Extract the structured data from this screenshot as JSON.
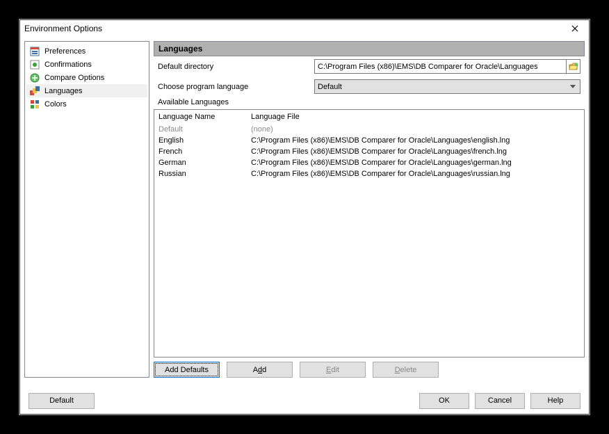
{
  "window": {
    "title": "Environment Options"
  },
  "sidebar": {
    "items": [
      {
        "label": "Preferences"
      },
      {
        "label": "Confirmations"
      },
      {
        "label": "Compare Options"
      },
      {
        "label": "Languages"
      },
      {
        "label": "Colors"
      }
    ]
  },
  "main": {
    "section_title": "Languages",
    "dir_label": "Default directory",
    "dir_value": "C:\\Program Files (x86)\\EMS\\DB Comparer for Oracle\\Languages",
    "lang_label": "Choose program language",
    "lang_value": "Default",
    "avail_label": "Available Languages",
    "columns": {
      "name": "Language Name",
      "file": "Language File"
    },
    "rows": [
      {
        "name": "Default",
        "file": "(none)",
        "grayed": true
      },
      {
        "name": "English",
        "file": "C:\\Program Files (x86)\\EMS\\DB Comparer for Oracle\\Languages\\english.lng"
      },
      {
        "name": "French",
        "file": "C:\\Program Files (x86)\\EMS\\DB Comparer for Oracle\\Languages\\french.lng"
      },
      {
        "name": "German",
        "file": "C:\\Program Files (x86)\\EMS\\DB Comparer for Oracle\\Languages\\german.lng"
      },
      {
        "name": "Russian",
        "file": "C:\\Program Files (x86)\\EMS\\DB Comparer for Oracle\\Languages\\russian.lng"
      }
    ],
    "buttons": {
      "add_defaults": "Add Defaults",
      "add_pre": "A",
      "add_ul": "d",
      "add_post": "d",
      "edit_pre": "",
      "edit_ul": "E",
      "edit_post": "dit",
      "delete_pre": "",
      "delete_ul": "D",
      "delete_post": "elete"
    }
  },
  "footer": {
    "default_pre": "De",
    "default_ul": "f",
    "default_post": "ault",
    "ok_pre": "",
    "ok_ul": "O",
    "ok_post": "K",
    "cancel": "Cancel",
    "help_pre": "",
    "help_ul": "H",
    "help_post": "elp"
  }
}
